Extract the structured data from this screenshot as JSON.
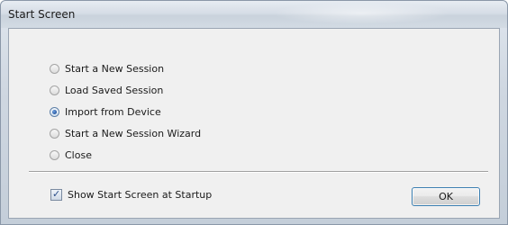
{
  "window": {
    "title": "Start Screen"
  },
  "options": [
    {
      "label": "Start a New Session",
      "checked": false
    },
    {
      "label": "Load Saved Session",
      "checked": false
    },
    {
      "label": "Import from Device",
      "checked": true
    },
    {
      "label": "Start a New Session Wizard",
      "checked": false
    },
    {
      "label": "Close",
      "checked": false
    }
  ],
  "startup": {
    "label": "Show Start Screen at Startup",
    "checked": true
  },
  "buttons": {
    "ok_label": "OK"
  },
  "colors": {
    "accent": "#3c7fb1",
    "dialog_background": "#f0f0f0"
  }
}
